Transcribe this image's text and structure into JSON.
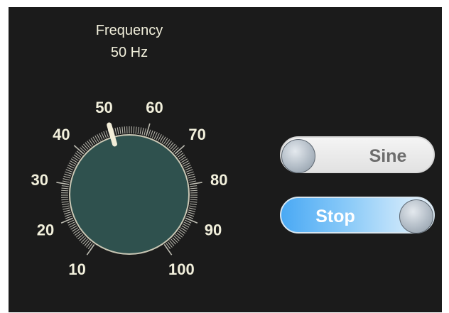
{
  "frequency": {
    "title": "Frequency",
    "value_text": "50 Hz",
    "value": 50,
    "dial": {
      "min": 10,
      "max": 100,
      "tick_labels": [
        "10",
        "20",
        "30",
        "40",
        "50",
        "60",
        "70",
        "80",
        "90",
        "100"
      ]
    }
  },
  "waveform_toggle": {
    "label": "Sine"
  },
  "run_toggle": {
    "label": "Stop"
  },
  "colors": {
    "panel_background": "#1b1b1b",
    "label_text": "#f2f0dc",
    "knob_face": "#2f514e",
    "knob_rim": "#c9c7b5",
    "pointer": "#f2edd8",
    "tick": "#bdbcb2",
    "stop_toggle_accent": "#4aa9f4",
    "sine_toggle_text": "#6d6d6d"
  }
}
